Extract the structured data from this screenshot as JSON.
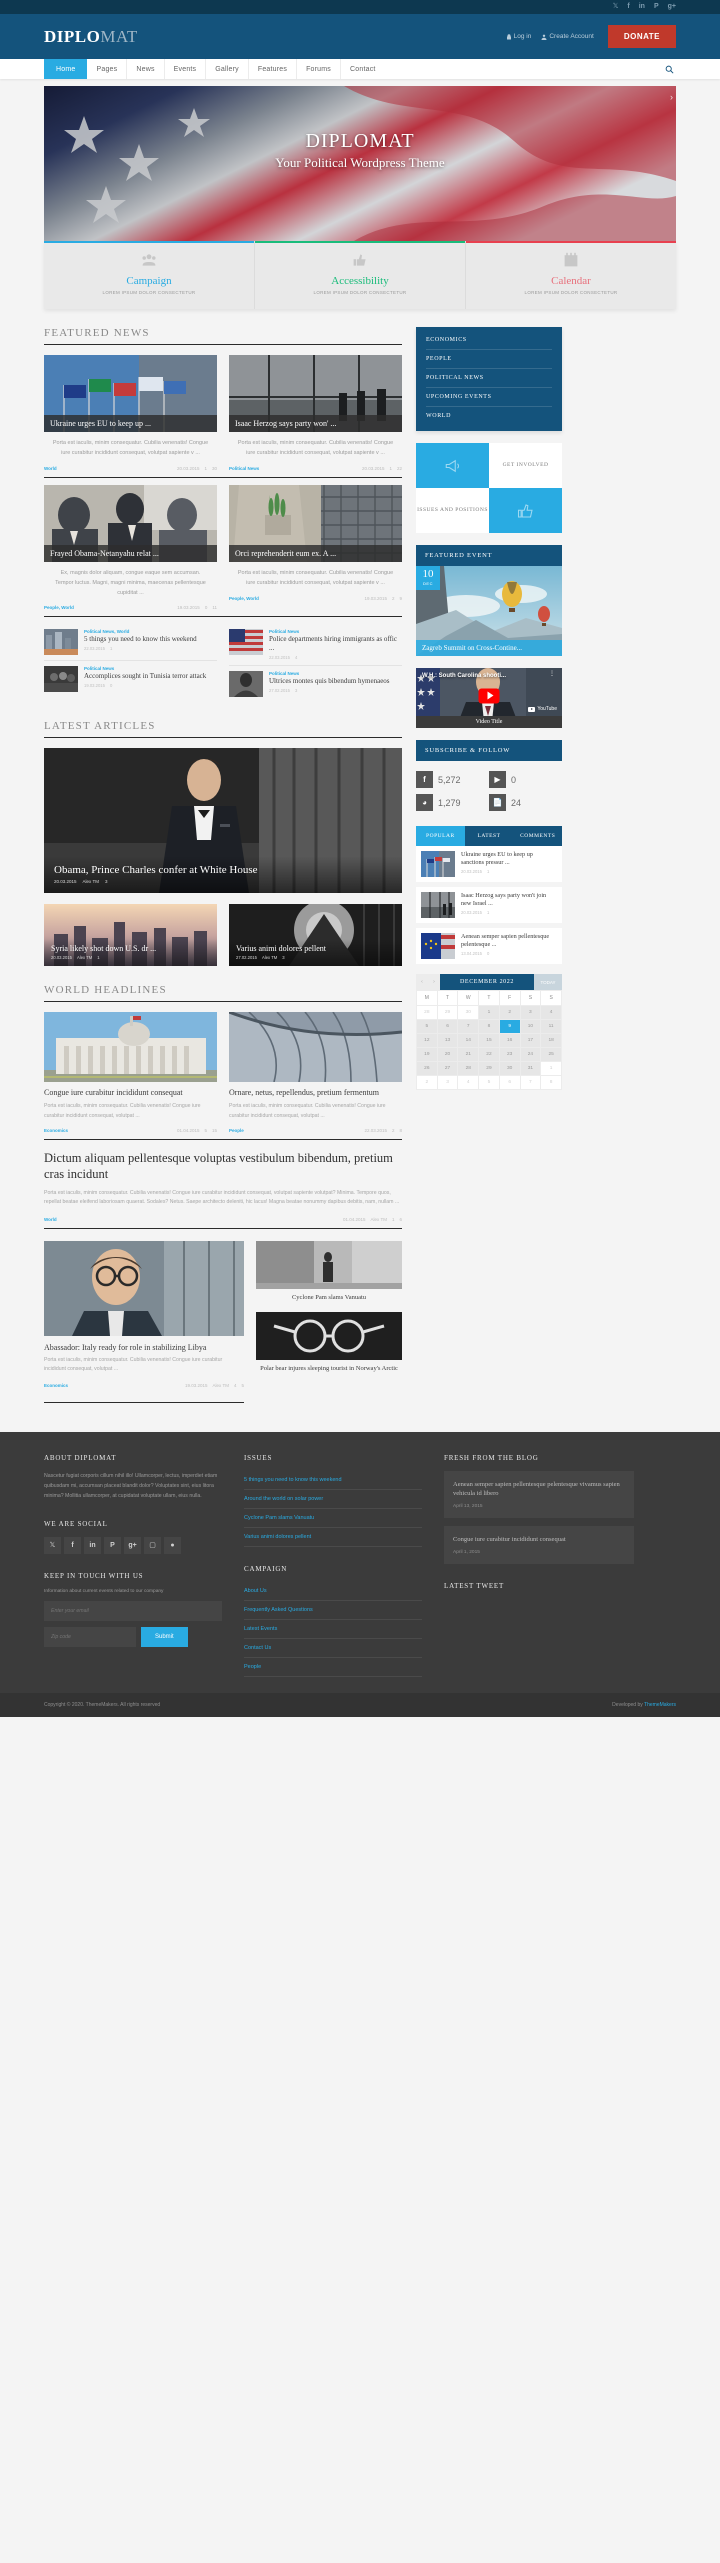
{
  "topbar": {
    "socials": [
      "twitter-icon",
      "facebook-icon",
      "linkedin-icon",
      "pinterest-icon",
      "googleplus-icon"
    ]
  },
  "header": {
    "logo_bold": "DIPLO",
    "logo_light": "MAT",
    "login_label": "Log in",
    "create_account_label": "Create Account",
    "donate_label": "DONATE"
  },
  "nav": {
    "items": [
      "Home",
      "Pages",
      "News",
      "Events",
      "Gallery",
      "Features",
      "Forums",
      "Contact"
    ],
    "active": "Home"
  },
  "hero": {
    "title": "DIPLOMAT",
    "subtitle": "Your Political Wordpress Theme"
  },
  "promos": [
    {
      "title": "Campaign",
      "desc": "LOREM IPSUM DOLOR CONSECTETUR",
      "color": "#29abe2",
      "icon": "people-icon"
    },
    {
      "title": "Accessibility",
      "desc": "LOREM IPSUM DOLOR CONSECTETUR",
      "color": "#1abc7b",
      "icon": "thumbs-up-icon"
    },
    {
      "title": "Calendar",
      "desc": "LOREM IPSUM DOLOR CONSECTETUR",
      "color": "#e8404f",
      "icon": "calendar-icon"
    }
  ],
  "featured_news": {
    "heading": "FEATURED NEWS",
    "cards": [
      {
        "title": "Ukraine urges EU to keep up ...",
        "excerpt": "Porta est iaculis, minim consequatur. Cubilia venenatis! Congue iure curabitur incididunt consequat, volutpat sapiente v ...",
        "category": "World",
        "date": "20.03.2015",
        "comments": "1",
        "likes": "30"
      },
      {
        "title": "Isaac Herzog says party won' ...",
        "excerpt": "Porta est iaculis, minim consequatur. Cubilia venenatis! Congue iure curabitur incididunt consequat, volutpat sapiente v ...",
        "category": "Political News",
        "date": "20.03.2015",
        "comments": "1",
        "likes": "22"
      },
      {
        "title": "Frayed Obama-Netanyahu relat ...",
        "excerpt": "Ex, magnis dolor aliquam, congue eaque sem accumsan. Tempor luctus. Magni, magni minima, maecenas pellentesque cupiditat ...",
        "category": "People, World",
        "date": "19.03.2015",
        "comments": "0",
        "likes": "11"
      },
      {
        "title": "Orci reprehenderit eum ex. A ...",
        "excerpt": "Porta est iaculis, minim consequatur. Cubilia venenatis! Congue iure curabitur incididunt consequat, volutpat sapiente v ...",
        "category": "People, World",
        "date": "19.03.2015",
        "comments": "2",
        "likes": "9"
      }
    ],
    "minis": [
      {
        "category": "Political News, World",
        "title": "5 things you need to know this weekend",
        "date": "22.03.2015",
        "comments": "1"
      },
      {
        "category": "Political News",
        "title": "Police departments hiring immigrants as offic ...",
        "date": "22.03.2015",
        "comments": "4"
      },
      {
        "category": "Political News",
        "title": "Accomplices sought in Tunisia terror attack",
        "date": "19.03.2015",
        "comments": "0"
      },
      {
        "category": "Political News",
        "title": "Ultrices montes quis bibendum hymenaeos",
        "date": "27.02.2015",
        "comments": "3"
      }
    ]
  },
  "latest_articles": {
    "heading": "LATEST ARTICLES",
    "main": {
      "title": "Obama, Prince Charles confer at White House",
      "date": "20.03.2015",
      "author": "Alex TM",
      "comments": "3"
    },
    "secondary": [
      {
        "title": "Syria likely shot down U.S. dr ...",
        "date": "20.03.2015",
        "author": "Alex TM",
        "comments": "1"
      },
      {
        "title": "Varius animi dolores pellent",
        "date": "27.02.2015",
        "author": "Alex TM",
        "comments": "3"
      }
    ]
  },
  "world_headlines": {
    "heading": "WORLD HEADLINES",
    "cards": [
      {
        "title": "Congue iure curabitur incididunt consequat",
        "excerpt": "Porta est iaculis, minim consequatur. Cubilia venenatis! Congue iure curabitur incididunt consequat, volutpat ...",
        "category": "Economics",
        "date": "01.04.2015",
        "comments": "5",
        "likes": "15"
      },
      {
        "title": "Ornare, netus, repellendus, pretium fermentum",
        "excerpt": "Porta est iaculis, minim consequatur. Cubilia venenatis! Congue iure curabitur incididunt consequat, volutpat ...",
        "category": "People",
        "date": "22.03.2015",
        "comments": "2",
        "likes": "8"
      }
    ],
    "wide_post": {
      "title": "Dictum aliquam pellentesque voluptas vestibulum bibendum, pretium cras incidunt",
      "excerpt": "Porta est iaculis, minim consequatur. Cubilia venenatis! Congue iure curabitur incididunt consequat, volutpat sapiente volutpat? Minima. Tempore quos, repellat beatae eleifend laboriosam quaerat. Sodales? Netus. Saepe architecto deleniti, hic lacus! Magna beatae nonummy dapibus debitis, nam, nullam ...",
      "category": "World",
      "date": "01.04.2015",
      "author": "Alex TM",
      "comments": "1",
      "likes": "6"
    },
    "bottom_left": {
      "title": "Abassador: Italy ready for role in stabilizing Libya",
      "excerpt": "Porta est iaculis, minim consequatur. Cubilia venenatis! Congue iure curabitur incididunt consequat, volutpat ...",
      "category": "Economics",
      "date": "19.03.2015",
      "author": "Alex TM",
      "comments": "4",
      "likes": "5"
    },
    "bottom_right": [
      {
        "title": "Cyclone Pam slams Vanuatu"
      },
      {
        "title": "Polar bear injures sleeping tourist in Norway's Arctic"
      }
    ]
  },
  "sidebar": {
    "categories": [
      "ECONOMICS",
      "PEOPLE",
      "POLITICAL NEWS",
      "UPCOMING EVENTS",
      "WORLD"
    ],
    "tiles": [
      {
        "type": "icon",
        "icon": "megaphone-icon",
        "style": "blue"
      },
      {
        "type": "label",
        "label": "GET INVOLVED",
        "style": "white"
      },
      {
        "type": "label",
        "label": "ISSUES AND POSITIONS",
        "style": "white"
      },
      {
        "type": "icon",
        "icon": "thumbs-up-icon",
        "style": "blue"
      }
    ],
    "featured_event": {
      "heading": "FEATURED EVENT",
      "day": "10",
      "month": "DEC",
      "title": "Zagreb Summit on Cross-Contine..."
    },
    "video": {
      "overlay_title": "W.H.: South Carolina shooti...",
      "brand": "YouTube",
      "caption": "Video Title"
    },
    "subscribe": {
      "heading": "SUBSCRIBE & FOLLOW",
      "counts": [
        {
          "icon": "facebook-icon",
          "value": "5,272"
        },
        {
          "icon": "youtube-icon",
          "value": "0"
        },
        {
          "icon": "rss-icon",
          "value": "1,279"
        },
        {
          "icon": "posts-icon",
          "value": "24"
        }
      ]
    },
    "tabs": {
      "items": [
        "POPULAR",
        "LATEST",
        "COMMENTS"
      ],
      "active": "POPULAR"
    },
    "tab_list": [
      {
        "title": "Ukraine urges EU to keep up sanctions pressur ...",
        "date": "20.03.2015",
        "comments": "1"
      },
      {
        "title": "Isaac Herzog says party won't join new Israel ...",
        "date": "20.03.2015",
        "comments": "1"
      },
      {
        "title": "Aenean semper sapien pellentesque pelentesque ...",
        "date": "13.04.2015",
        "comments": "0"
      }
    ],
    "calendar": {
      "title": "DECEMBER 2022",
      "today_label": "TODAY",
      "prev": "‹",
      "next": "›",
      "weekdays": [
        "M",
        "T",
        "W",
        "T",
        "F",
        "S",
        "S"
      ],
      "weeks": [
        [
          {
            "d": "28",
            "off": true
          },
          {
            "d": "29",
            "off": true
          },
          {
            "d": "30",
            "off": true
          },
          {
            "d": "1"
          },
          {
            "d": "2"
          },
          {
            "d": "3"
          },
          {
            "d": "4"
          }
        ],
        [
          {
            "d": "5"
          },
          {
            "d": "6"
          },
          {
            "d": "7"
          },
          {
            "d": "8"
          },
          {
            "d": "9",
            "sel": true
          },
          {
            "d": "10"
          },
          {
            "d": "11"
          }
        ],
        [
          {
            "d": "12"
          },
          {
            "d": "13"
          },
          {
            "d": "14"
          },
          {
            "d": "15"
          },
          {
            "d": "16"
          },
          {
            "d": "17"
          },
          {
            "d": "18"
          }
        ],
        [
          {
            "d": "19"
          },
          {
            "d": "20"
          },
          {
            "d": "21"
          },
          {
            "d": "22"
          },
          {
            "d": "23"
          },
          {
            "d": "24"
          },
          {
            "d": "25"
          }
        ],
        [
          {
            "d": "26"
          },
          {
            "d": "27"
          },
          {
            "d": "28"
          },
          {
            "d": "29"
          },
          {
            "d": "30"
          },
          {
            "d": "31"
          },
          {
            "d": "1",
            "off": true
          }
        ],
        [
          {
            "d": "2",
            "off": true
          },
          {
            "d": "3",
            "off": true
          },
          {
            "d": "4",
            "off": true
          },
          {
            "d": "5",
            "off": true
          },
          {
            "d": "6",
            "off": true
          },
          {
            "d": "7",
            "off": true
          },
          {
            "d": "8",
            "off": true
          }
        ]
      ]
    }
  },
  "footer": {
    "about": {
      "heading": "ABOUT DIPLOMAT",
      "text": "Nascetur fugiat corporis cillum nihil illo! Ullamcorper, lectus, imperdiet etiam quibusdam mi, accumsan placeat blandit dolor? Voluptates sint, eius litora minima? Mollitia ullamcorper, at cupidatat voluptate ullam, eius nulla."
    },
    "social": {
      "heading": "WE ARE SOCIAL",
      "icons": [
        "twitter-icon",
        "facebook-icon",
        "linkedin-icon",
        "pinterest-icon",
        "googleplus-icon",
        "instagram-icon",
        "dribbble-icon"
      ]
    },
    "newsletter": {
      "heading": "KEEP IN TOUCH WITH US",
      "sub": "Information about current events related to our company",
      "email_placeholder": "Enter your email",
      "zip_placeholder": "Zip code",
      "submit_label": "Submit"
    },
    "issues": {
      "heading": "ISSUES",
      "links": [
        "5 things you need to know this weekend",
        "Around the world on solar power",
        "Cyclone Pam slams Vanuatu",
        "Varius animi dolores pellent"
      ]
    },
    "campaign": {
      "heading": "CAMPAIGN",
      "links": [
        "About Us",
        "Frequently Asked Questions",
        "Latest Events",
        "Contact Us",
        "People"
      ]
    },
    "blog": {
      "heading": "FRESH FROM THE BLOG",
      "posts": [
        {
          "title": "Aenean semper sapien pellentesque pelentesque vivamus sapien vehicula id libero",
          "date": "April 13, 2015"
        },
        {
          "title": "Congue iure curabitur incididunt consequat",
          "date": "April 1, 2015"
        }
      ]
    },
    "tweet": {
      "heading": "LATEST TWEET"
    },
    "copyright": "Copyright © 2020. ThemeMakers. All rights reserved",
    "developed_prefix": "Developed by ",
    "developed_by": "ThemeMakers"
  }
}
